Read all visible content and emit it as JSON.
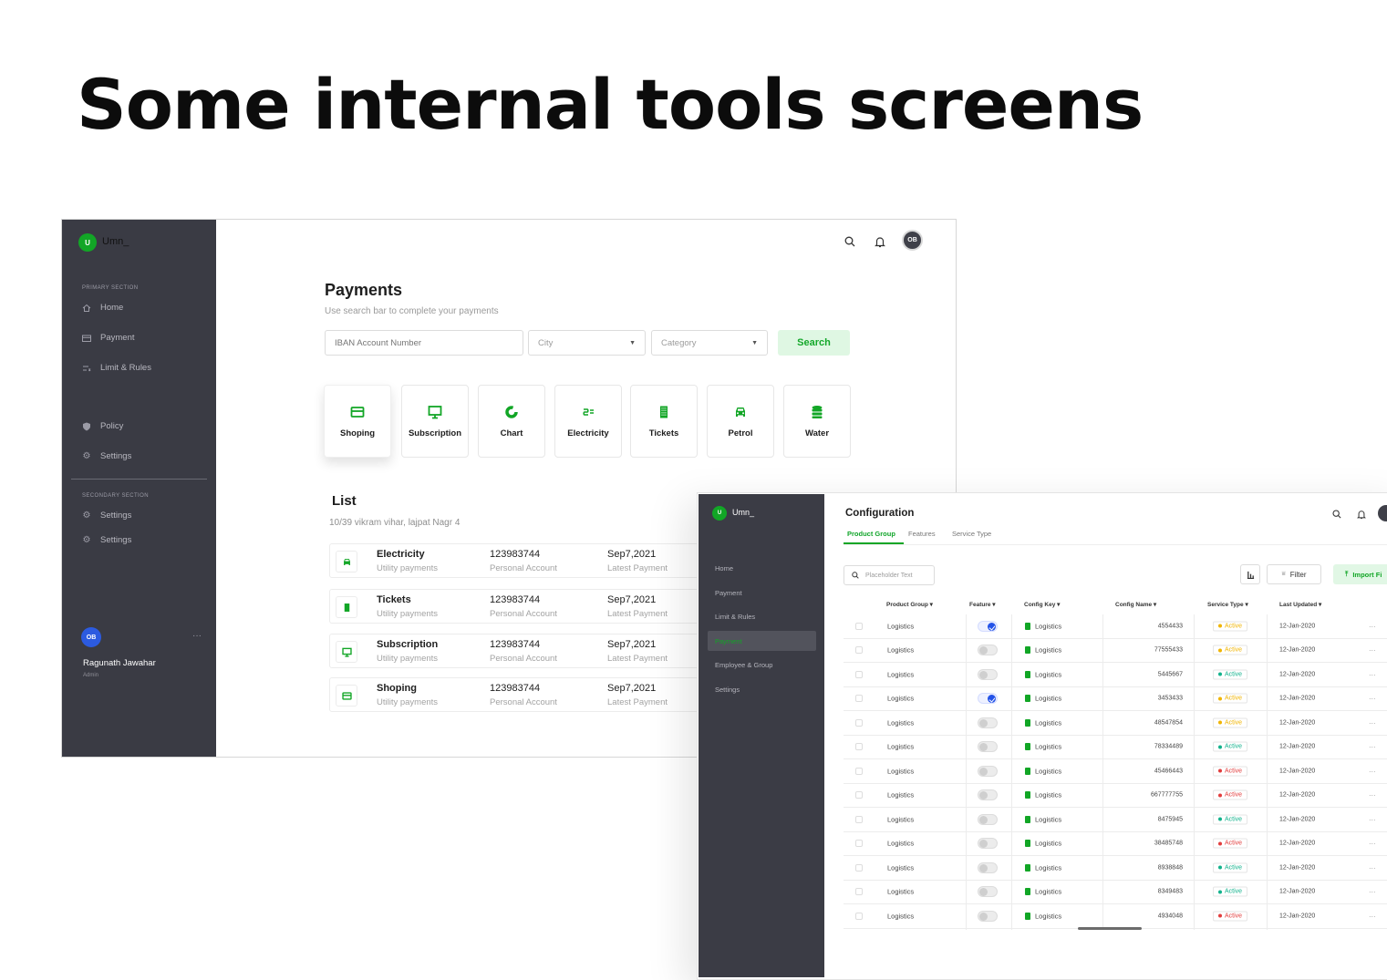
{
  "headline": "Some internal tools screens",
  "colors": {
    "brand_green": "#12a626",
    "sidebar_bg": "#3a3b44",
    "avatar_blue": "#2c5be0",
    "status_yellow": "#f0b400",
    "status_teal": "#12b28c",
    "status_red": "#e23d3d"
  },
  "payments_screen": {
    "brand": {
      "letter": "U",
      "name": "Umn_"
    },
    "sidebar": {
      "primary_label": "PRIMARY SECTION",
      "primary_items": [
        {
          "label": "Home",
          "icon": "home-icon"
        },
        {
          "label": "Payment",
          "icon": "card-icon"
        },
        {
          "label": "Limit & Rules",
          "icon": "limit-icon"
        }
      ],
      "extra_items": [
        {
          "label": "Policy",
          "icon": "shield-icon"
        },
        {
          "label": "Settings",
          "icon": "gear-icon"
        }
      ],
      "secondary_label": "SECONDARY SECTION",
      "secondary_items": [
        {
          "label": "Settings",
          "icon": "gear-icon"
        },
        {
          "label": "Settings",
          "icon": "gear-icon"
        }
      ],
      "user": {
        "initials": "OB",
        "name": "Ragunath Jawahar",
        "role": "Admin",
        "more": "···"
      }
    },
    "header": {
      "avatar": "OB"
    },
    "title": "Payments",
    "subtitle": "Use search bar to complete your payments",
    "search": {
      "iban_placeholder": "IBAN Account Number",
      "city": "City",
      "category": "Category",
      "button": "Search"
    },
    "categories": [
      {
        "label": "Shoping",
        "icon": "card-icon"
      },
      {
        "label": "Subscription",
        "icon": "monitor-icon"
      },
      {
        "label": "Chart",
        "icon": "chart-icon"
      },
      {
        "label": "Electricity",
        "icon": "plug-icon"
      },
      {
        "label": "Tickets",
        "icon": "ticket-icon"
      },
      {
        "label": "Petrol",
        "icon": "car-icon"
      },
      {
        "label": "Water",
        "icon": "database-icon"
      }
    ],
    "list": {
      "title": "List",
      "subtitle": "10/39 vikram vihar, lajpat Nagr 4",
      "rows": [
        {
          "name": "Electricity",
          "type": "Utility payments",
          "account": "123983744",
          "account_label": "Personal Account",
          "date": "Sep7,2021",
          "date_label": "Latest Payment",
          "icon": "car-icon"
        },
        {
          "name": "Tickets",
          "type": "Utility payments",
          "account": "123983744",
          "account_label": "Personal Account",
          "date": "Sep7,2021",
          "date_label": "Latest Payment",
          "icon": "ticket-icon"
        },
        {
          "name": "Subscription",
          "type": "Utility payments",
          "account": "123983744",
          "account_label": "Personal Account",
          "date": "Sep7,2021",
          "date_label": "Latest Payment",
          "icon": "monitor-icon"
        },
        {
          "name": "Shoping",
          "type": "Utility payments",
          "account": "123983744",
          "account_label": "Personal Account",
          "date": "Sep7,2021",
          "date_label": "Latest Payment",
          "icon": "card-icon"
        }
      ]
    }
  },
  "config_screen": {
    "brand": {
      "letter": "U",
      "name": "Umn_"
    },
    "sidebar_items": [
      "Home",
      "Payment",
      "Limit & Rules",
      "Payment",
      "Employee & Group",
      "Settings"
    ],
    "active_sidebar_index": 3,
    "title": "Configuration",
    "tabs": [
      "Product Group",
      "Features",
      "Service Type"
    ],
    "search_placeholder": "Placeholder Text",
    "filter": "Filter",
    "import": "Import Fi",
    "columns": [
      "Product Group",
      "Feature",
      "Config Key",
      "Config Name",
      "Service Type",
      "Last Updated"
    ],
    "rows": [
      {
        "group": "Logistics",
        "feature": true,
        "key": "Logistics",
        "name": "4554433",
        "status": "Active",
        "status_color": "yellow",
        "date": "12-Jan-2020"
      },
      {
        "group": "Logistics",
        "feature": false,
        "key": "Logistics",
        "name": "77555433",
        "status": "Active",
        "status_color": "yellow",
        "date": "12-Jan-2020"
      },
      {
        "group": "Logistics",
        "feature": false,
        "key": "Logistics",
        "name": "5445667",
        "status": "Active",
        "status_color": "teal",
        "date": "12-Jan-2020"
      },
      {
        "group": "Logistics",
        "feature": true,
        "key": "Logistics",
        "name": "3453433",
        "status": "Active",
        "status_color": "yellow",
        "date": "12-Jan-2020"
      },
      {
        "group": "Logistics",
        "feature": false,
        "key": "Logistics",
        "name": "48547854",
        "status": "Active",
        "status_color": "yellow",
        "date": "12-Jan-2020"
      },
      {
        "group": "Logistics",
        "feature": false,
        "key": "Logistics",
        "name": "78334489",
        "status": "Active",
        "status_color": "teal",
        "date": "12-Jan-2020"
      },
      {
        "group": "Logistics",
        "feature": false,
        "key": "Logistics",
        "name": "45466443",
        "status": "Active",
        "status_color": "red",
        "date": "12-Jan-2020"
      },
      {
        "group": "Logistics",
        "feature": false,
        "key": "Logistics",
        "name": "667777755",
        "status": "Active",
        "status_color": "red",
        "date": "12-Jan-2020"
      },
      {
        "group": "Logistics",
        "feature": false,
        "key": "Logistics",
        "name": "8475945",
        "status": "Active",
        "status_color": "teal",
        "date": "12-Jan-2020"
      },
      {
        "group": "Logistics",
        "feature": false,
        "key": "Logistics",
        "name": "38485748",
        "status": "Active",
        "status_color": "red",
        "date": "12-Jan-2020"
      },
      {
        "group": "Logistics",
        "feature": false,
        "key": "Logistics",
        "name": "8938848",
        "status": "Active",
        "status_color": "teal",
        "date": "12-Jan-2020"
      },
      {
        "group": "Logistics",
        "feature": false,
        "key": "Logistics",
        "name": "8349483",
        "status": "Active",
        "status_color": "teal",
        "date": "12-Jan-2020"
      },
      {
        "group": "Logistics",
        "feature": false,
        "key": "Logistics",
        "name": "4934048",
        "status": "Active",
        "status_color": "red",
        "date": "12-Jan-2020"
      }
    ],
    "row_more": "···"
  }
}
